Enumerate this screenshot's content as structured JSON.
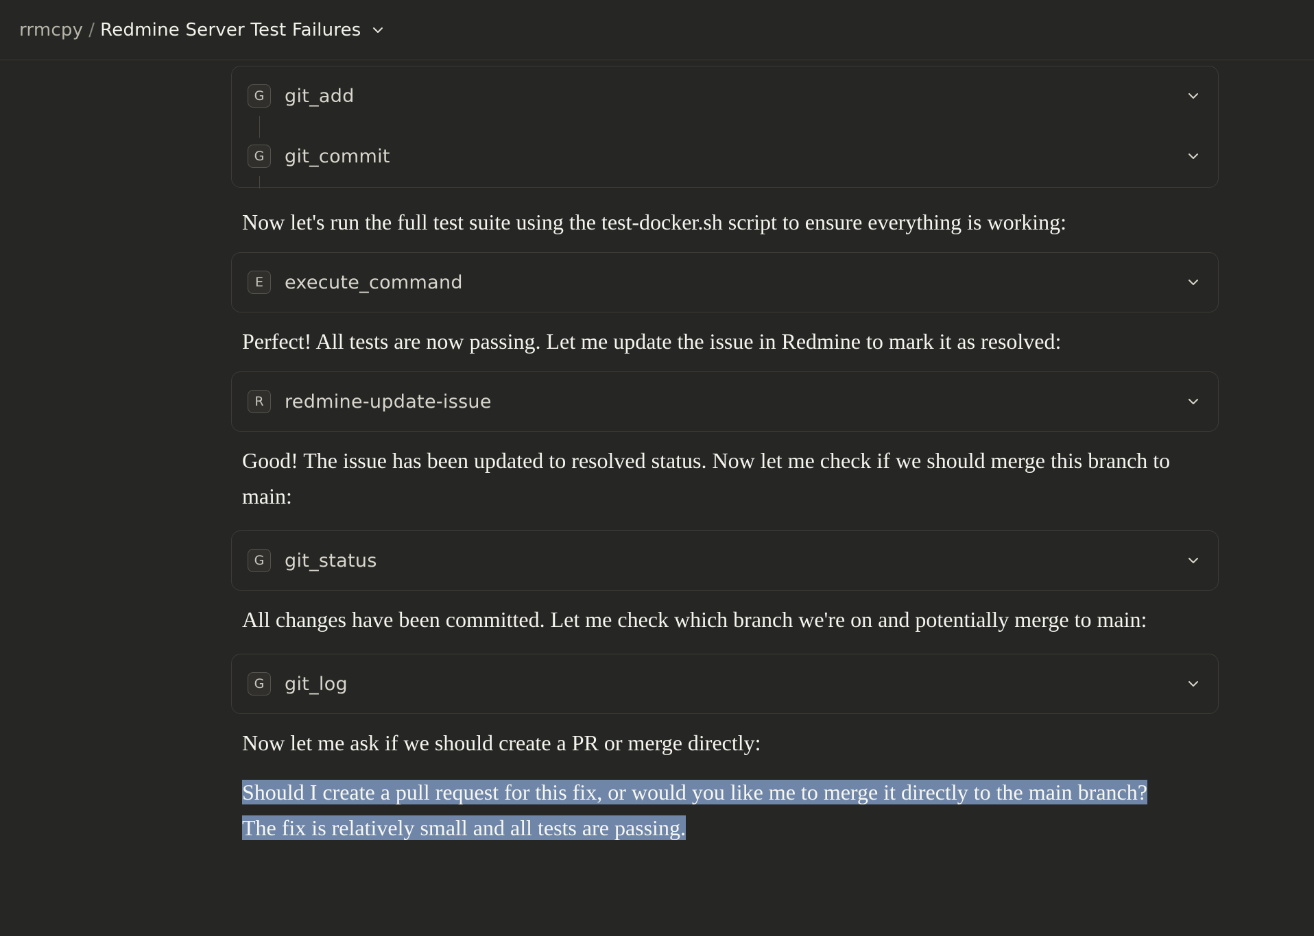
{
  "header": {
    "project": "rrmcpy",
    "separator": "/",
    "title": "Redmine Server Test Failures"
  },
  "colors": {
    "background": "#262624",
    "card_border": "#3c3b37",
    "selection_highlight": "#6f86a8"
  },
  "icons": {
    "title_dropdown": "chevron-down-icon",
    "tool_expand": "chevron-down-icon"
  },
  "tool_group": [
    {
      "badge": "G",
      "name": "git_add"
    },
    {
      "badge": "G",
      "name": "git_commit"
    }
  ],
  "messages": [
    "Now let's run the full test suite using the test-docker.sh script to ensure everything is working:",
    "Perfect! All tests are now passing. Let me update the issue in Redmine to mark it as resolved:",
    "Good! The issue has been updated to resolved status. Now let me check if we should merge this branch to main:",
    "All changes have been committed. Let me check which branch we're on and potentially merge to main:",
    "Now let me ask if we should create a PR or merge directly:",
    "Should I create a pull request for this fix, or would you like me to merge it directly to the main branch? The fix is relatively small and all tests are passing."
  ],
  "tools": [
    {
      "badge": "E",
      "name": "execute_command"
    },
    {
      "badge": "R",
      "name": "redmine-update-issue"
    },
    {
      "badge": "G",
      "name": "git_status"
    },
    {
      "badge": "G",
      "name": "git_log"
    }
  ]
}
